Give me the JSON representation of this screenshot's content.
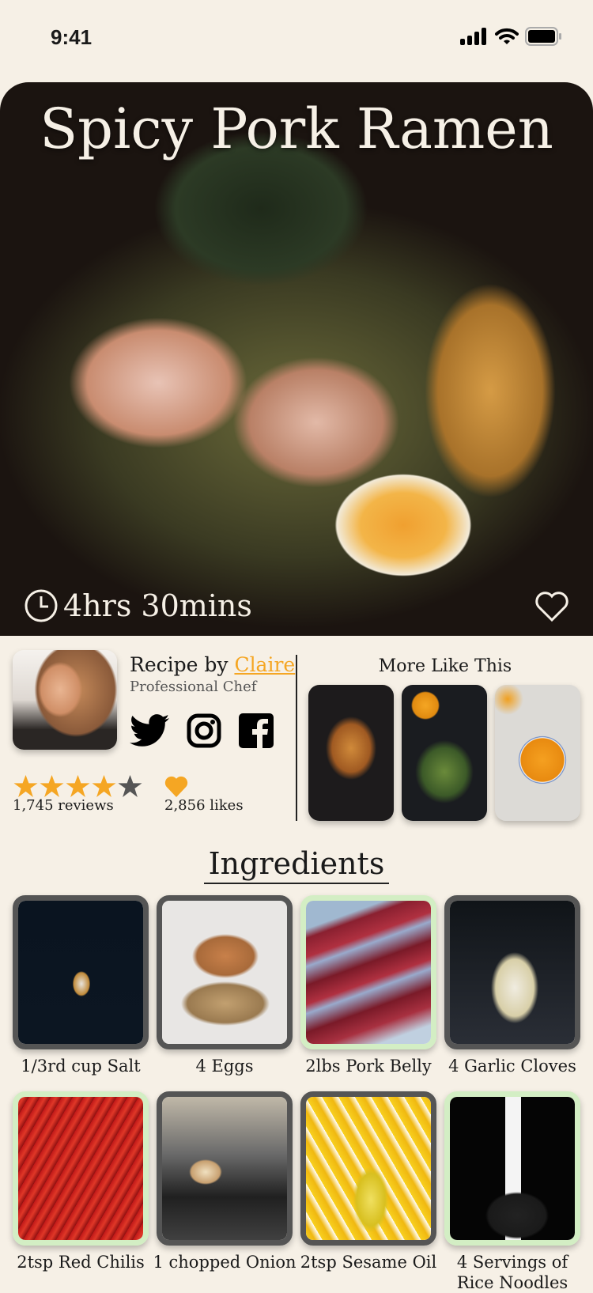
{
  "status_bar": {
    "time": "9:41"
  },
  "hero": {
    "title": "Spicy Pork Ramen",
    "cook_time": "4hrs 30mins",
    "favorited": false
  },
  "author": {
    "prefix": "Recipe by ",
    "name": "Claire",
    "role": "Professional Chef",
    "socials": [
      "twitter",
      "instagram",
      "facebook"
    ]
  },
  "rating": {
    "stars": 4,
    "max_stars": 5,
    "reviews": "1,745 reviews",
    "likes": "2,856 likes"
  },
  "more_like_this": {
    "title": "More Like This",
    "items": [
      "french-toast",
      "salad",
      "pumpkin-soup"
    ]
  },
  "ingredients": {
    "title": "Ingredients",
    "items": [
      {
        "label": "1/3rd cup Salt",
        "highlighted": false
      },
      {
        "label": "4 Eggs",
        "highlighted": false
      },
      {
        "label": "2lbs Pork Belly",
        "highlighted": true
      },
      {
        "label": "4 Garlic Cloves",
        "highlighted": false
      },
      {
        "label": "2tsp Red Chilis",
        "highlighted": true
      },
      {
        "label": "1 chopped Onion",
        "highlighted": false
      },
      {
        "label": "2tsp Sesame Oil",
        "highlighted": false
      },
      {
        "label": "4 Servings of Rice Noodles",
        "highlighted": true
      }
    ]
  },
  "colors": {
    "background": "#f6f0e6",
    "accent": "#f5a623",
    "highlight_border": "#d3eec4",
    "default_border": "#555555"
  }
}
